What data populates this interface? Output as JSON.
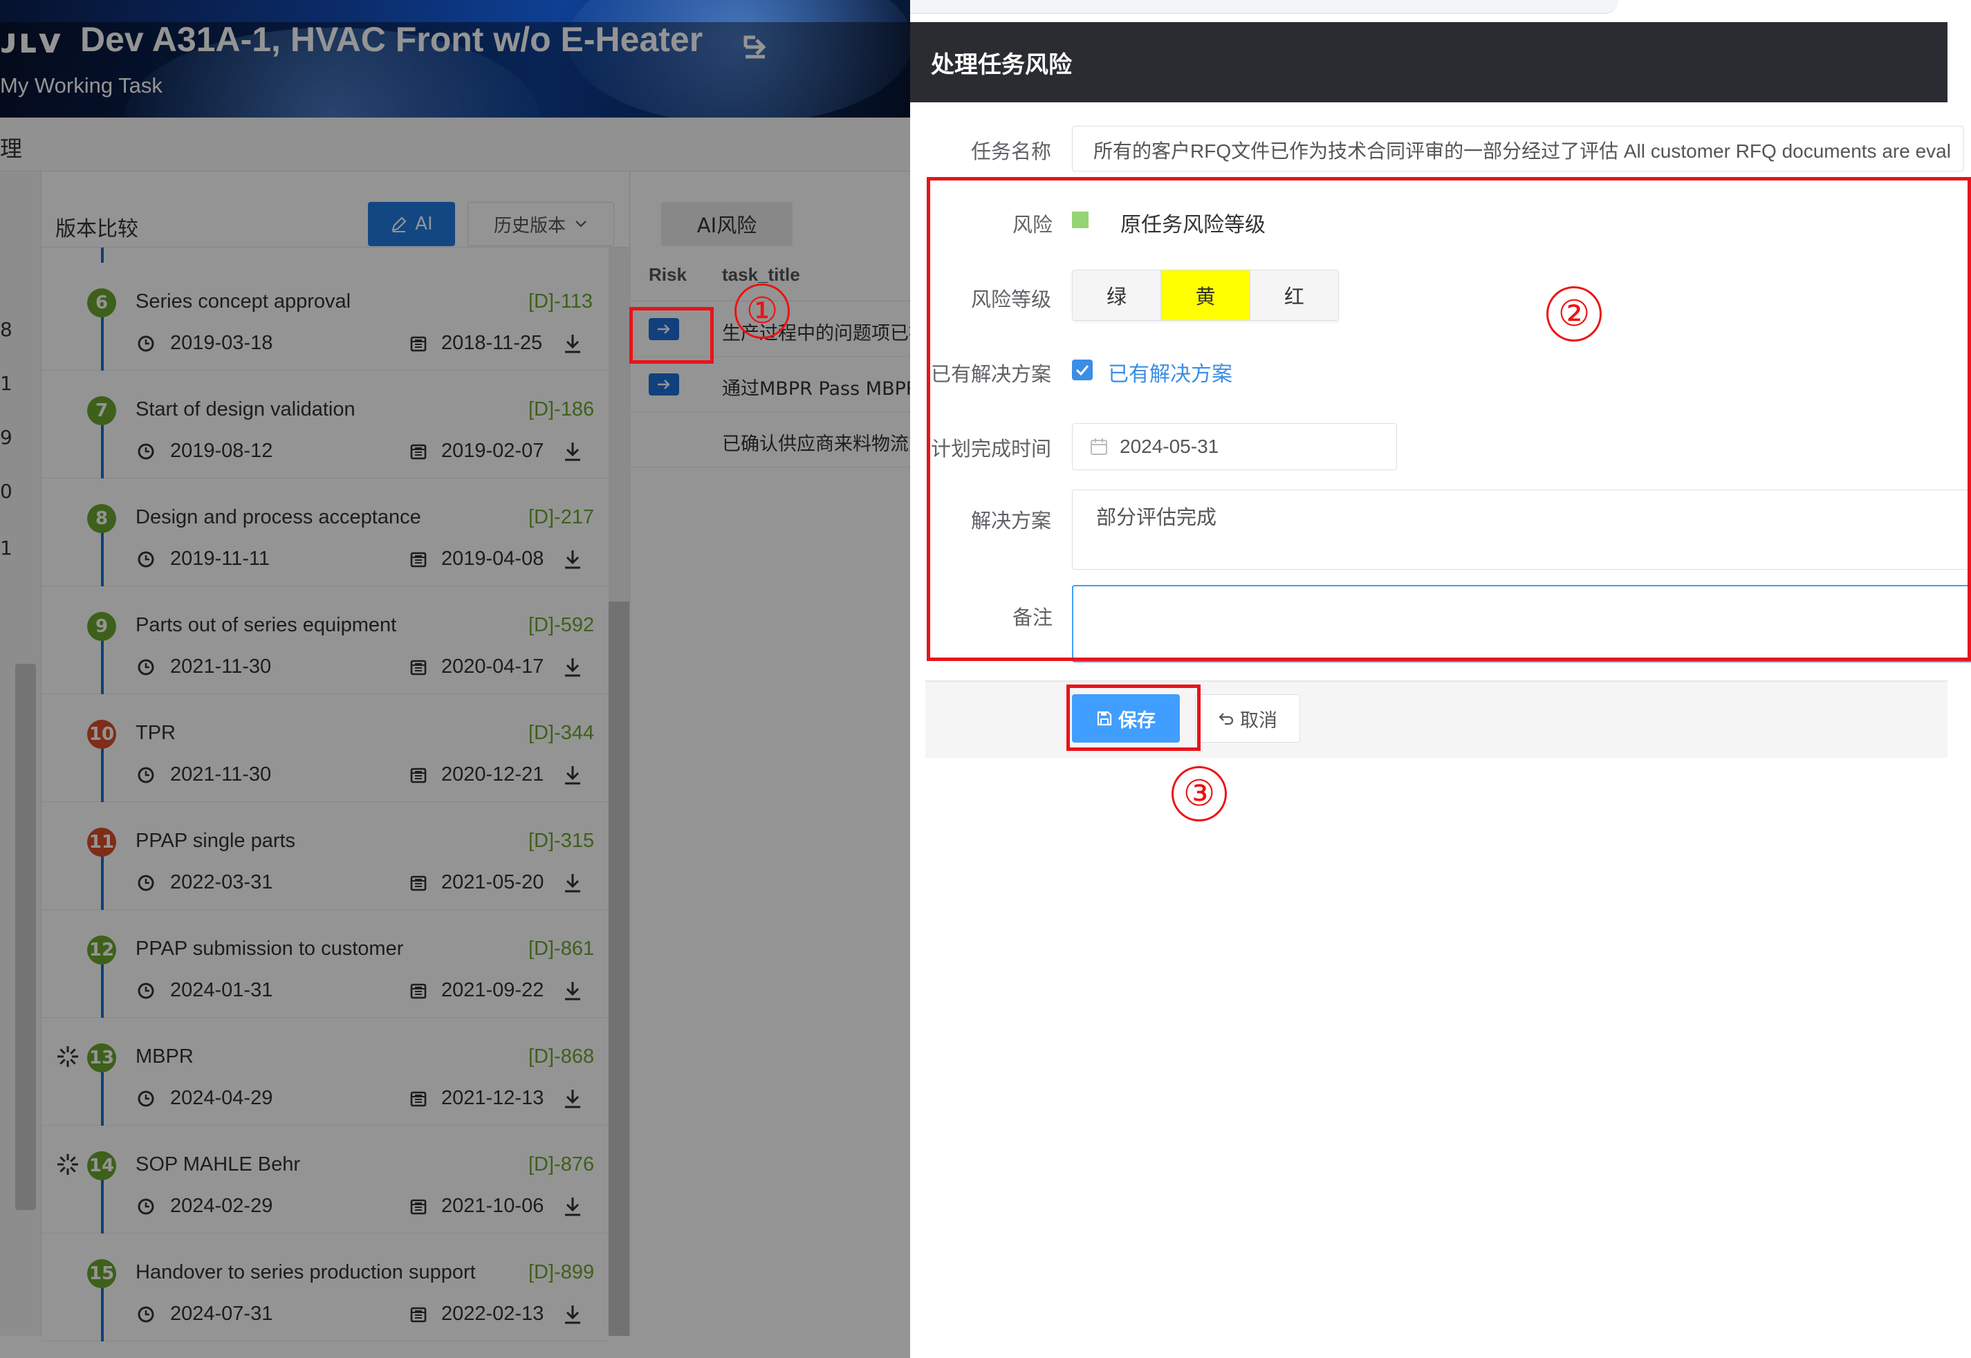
{
  "banner": {
    "brand": "ᴊʟᴠ",
    "project_title": "Dev A31A-1, HVAC Front w/o E-Heater",
    "subtitle": "My Working Task"
  },
  "tabs": {
    "manage": "理"
  },
  "left_column_numbers": [
    "8",
    "1",
    "9",
    "0",
    "1"
  ],
  "timeline": {
    "compare_label": "版本比较",
    "ai_button": "AI",
    "history_select": "历史版本",
    "milestones": [
      {
        "num": "6",
        "title": "Series concept approval",
        "code": "[D]-113",
        "date_plan": "2019-03-18",
        "date_base": "2018-11-25",
        "color": "#6aa530",
        "spinner": false
      },
      {
        "num": "7",
        "title": "Start of design validation",
        "code": "[D]-186",
        "date_plan": "2019-08-12",
        "date_base": "2019-02-07",
        "color": "#6aa530",
        "spinner": false
      },
      {
        "num": "8",
        "title": "Design and process acceptance",
        "code": "[D]-217",
        "date_plan": "2019-11-11",
        "date_base": "2019-04-08",
        "color": "#6aa530",
        "spinner": false
      },
      {
        "num": "9",
        "title": "Parts out of series equipment",
        "code": "[D]-592",
        "date_plan": "2021-11-30",
        "date_base": "2020-04-17",
        "color": "#6aa530",
        "spinner": false
      },
      {
        "num": "10",
        "title": "TPR",
        "code": "[D]-344",
        "date_plan": "2021-11-30",
        "date_base": "2020-12-21",
        "color": "#d94e2a",
        "spinner": false
      },
      {
        "num": "11",
        "title": "PPAP single parts",
        "code": "[D]-315",
        "date_plan": "2022-03-31",
        "date_base": "2021-05-20",
        "color": "#d94e2a",
        "spinner": false
      },
      {
        "num": "12",
        "title": "PPAP submission to customer",
        "code": "[D]-861",
        "date_plan": "2024-01-31",
        "date_base": "2021-09-22",
        "color": "#6aa530",
        "spinner": false
      },
      {
        "num": "13",
        "title": "MBPR",
        "code": "[D]-868",
        "date_plan": "2024-04-29",
        "date_base": "2021-12-13",
        "color": "#6aa530",
        "spinner": true
      },
      {
        "num": "14",
        "title": "SOP MAHLE Behr",
        "code": "[D]-876",
        "date_plan": "2024-02-29",
        "date_base": "2021-10-06",
        "color": "#6aa530",
        "spinner": true
      },
      {
        "num": "15",
        "title": "Handover to series production support",
        "code": "[D]-899",
        "date_plan": "2024-07-31",
        "date_base": "2022-02-13",
        "color": "#6aa530",
        "spinner": false
      }
    ]
  },
  "ai_risk": {
    "tab_label": "AI风险",
    "col_risk": "Risk",
    "col_title": "task_title",
    "rows": [
      {
        "text": "生产过程中的问题项已被",
        "has_button": true
      },
      {
        "text": "通过MBPR Pass MBPR",
        "has_button": true
      },
      {
        "text": "已确认供应商来料物流方",
        "has_button": false
      }
    ]
  },
  "drawer": {
    "title": "处理任务风险",
    "labels": {
      "task_name": "任务名称",
      "risk": "风险",
      "risk_level": "风险等级",
      "has_solution": "已有解决方案",
      "plan_date": "计划完成时间",
      "solution": "解决方案",
      "remark": "备注"
    },
    "task_name_value": "所有的客户RFQ文件已作为技术合同评审的一部分经过了评估 All customer RFQ documents are eval",
    "risk_original_label": "原任务风险等级",
    "risk_original_color": "#95d475",
    "levels": [
      "绿",
      "黄",
      "红"
    ],
    "selected_level": "黄",
    "has_solution_checked": true,
    "has_solution_check_label": "已有解决方案",
    "plan_date_value": "2024-05-31",
    "solution_value": "部分评估完成",
    "remark_value": "",
    "save_label": "保存",
    "cancel_label": "取消"
  },
  "annotations": {
    "marker1": "①",
    "marker2": "②",
    "marker3": "③"
  }
}
